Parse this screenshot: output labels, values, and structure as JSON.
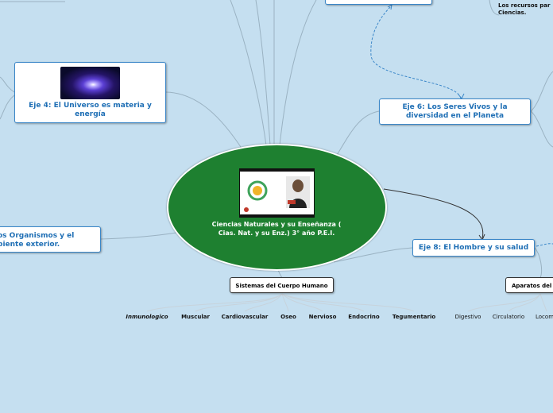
{
  "center": {
    "title": "Ciencias Naturales y su Enseñanza ( Cias. Nat. y su Enz.) 3° año P.E.I."
  },
  "nodes": {
    "eje4": "Eje  4: El Universo es materia y energía",
    "eje6": "Eje 6: Los Seres Vivos y la diversidad en el Planeta",
    "eje8": "Eje 8: El Hombre y su salud",
    "organismos": "os Organismos y el biente exterior.",
    "sistemas": "Sistemas del Cuerpo Humano",
    "aparatos": "Aparatos del"
  },
  "note": "Los recursos par Ciencias.",
  "sistemas_leaves": [
    "Inmunologico",
    "Muscular",
    "Cardiovascular",
    "Oseo",
    "Nervioso",
    "Endocrino",
    "Tegumentario"
  ],
  "aparatos_leaves": [
    "Digestivo",
    "Circulatorio",
    "Locom"
  ],
  "colors": {
    "background": "#c5dff0",
    "center": "#1e8030",
    "node_text": "#1f6fb5",
    "node_border": "#3a86c8"
  }
}
